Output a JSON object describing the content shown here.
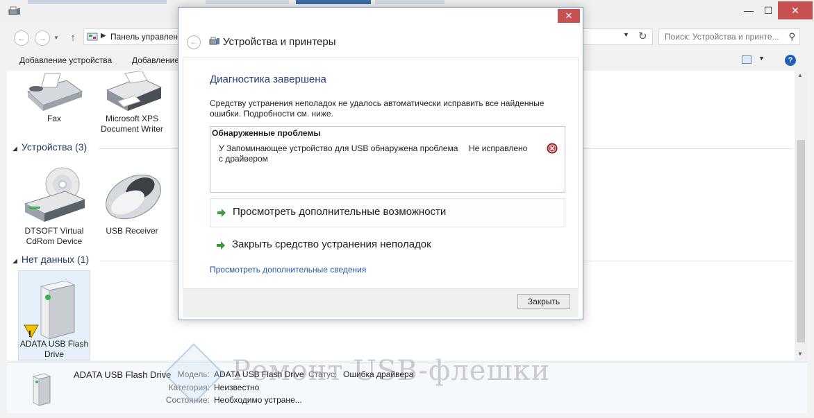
{
  "window": {
    "close_glyph": "✕",
    "minimize_glyph": "—",
    "maximize_glyph": "☐"
  },
  "address": {
    "path": "Панель управлен",
    "separator": "▶"
  },
  "search": {
    "placeholder": "Поиск: Устройства и принте..."
  },
  "toolbar": {
    "add_device": "Добавление устройства",
    "add_printer": "Добавление"
  },
  "groups": {
    "printers": [
      {
        "label": "Fax",
        "icon": "fax-icon"
      },
      {
        "label": "Microsoft XPS Document Writer",
        "icon": "printer-icon"
      }
    ],
    "devices_header": "Устройства (3)",
    "devices": [
      {
        "label": "DTSOFT Virtual CdRom Device",
        "icon": "cdrom-drive-icon"
      },
      {
        "label": "USB Receiver",
        "icon": "mouse-icon"
      }
    ],
    "nodata_header": "Нет данных (1)",
    "nodata": [
      {
        "label": "ADATA USB Flash Drive",
        "icon": "usb-drive-warning-icon"
      }
    ]
  },
  "details": {
    "name": "ADATA USB Flash Drive",
    "model_key": "Модель:",
    "model_val": "ADATA USB Flash Drive",
    "status_key": "Статус:",
    "status_val": "Ошибка драйвера",
    "category_key": "Категория:",
    "category_val": "Неизвестно",
    "state_key": "Состояние:",
    "state_val": "Необходимо устране..."
  },
  "dialog": {
    "title": "Устройства и принтеры",
    "heading": "Диагностика завершена",
    "description": "Средству устранения неполадок не удалось автоматически исправить все найденные ошибки. Подробности см. ниже.",
    "problems_title": "Обнаруженные проблемы",
    "problem_text": "У Запоминающее устройство для USB обнаружена проблема с драйвером",
    "problem_status": "Не исправлено",
    "option_more": "Просмотреть дополнительные возможности",
    "option_close": "Закрыть средство устранения неполадок",
    "more_link": "Просмотреть дополнительные сведения",
    "close_button": "Закрыть"
  },
  "watermark": {
    "text": "Ремонт USB-флешки"
  },
  "colors": {
    "accent": "#1e3c78",
    "link": "#1f5aa6",
    "close_red": "#c75050",
    "arrow_green": "#3a9a3a",
    "error_red": "#b3262b"
  }
}
